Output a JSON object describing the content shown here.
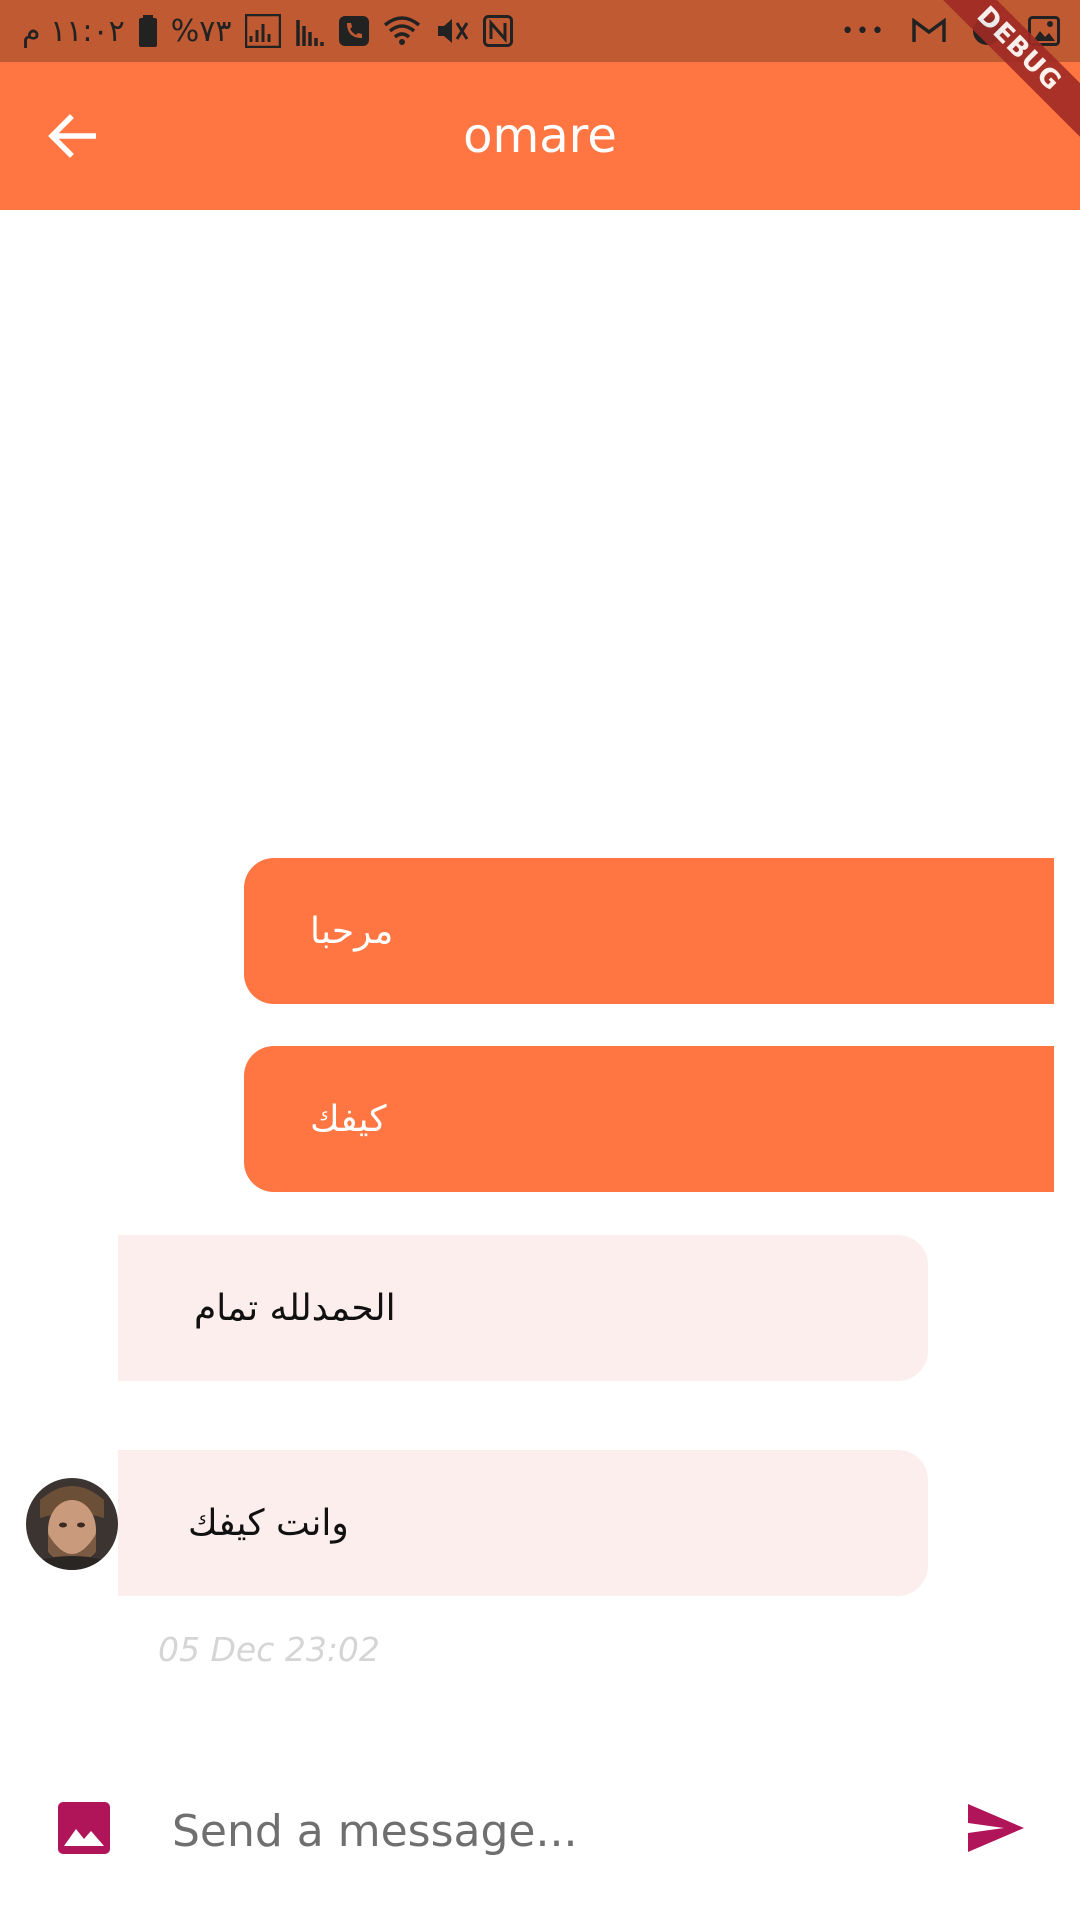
{
  "status_bar": {
    "time": "١١:٠٢ م",
    "battery": "%٧٣",
    "icons": [
      "battery-icon",
      "signal-icon",
      "signal-icon",
      "call-icon",
      "wifi-icon",
      "mute-icon",
      "nfc-icon",
      "more-icon",
      "gmail-icon",
      "notification-icon",
      "gallery-icon"
    ],
    "overflow": "•••"
  },
  "debug_banner": "DEBUG",
  "app_bar": {
    "back_icon": "arrow-back-icon",
    "title": "omare"
  },
  "messages": [
    {
      "direction": "sent",
      "text": "مرحبا"
    },
    {
      "direction": "sent",
      "text": "كيفك"
    },
    {
      "direction": "received",
      "text": "الحمدلله تمام"
    },
    {
      "direction": "received",
      "text": "وانت كيفك",
      "avatar": "avatar-photo"
    }
  ],
  "timestamp": "05 Dec 23:02",
  "composer": {
    "image_icon": "image-icon",
    "placeholder": "Send a message...",
    "value": "",
    "send_icon": "send-icon"
  },
  "colors": {
    "status_bar": "#bf5a33",
    "app_bar": "#ff7643",
    "sent_bubble": "#ff7643",
    "received_bubble": "#fdeeee",
    "accent_icons": "#b0155a",
    "timestamp": "#d5d5d5"
  }
}
